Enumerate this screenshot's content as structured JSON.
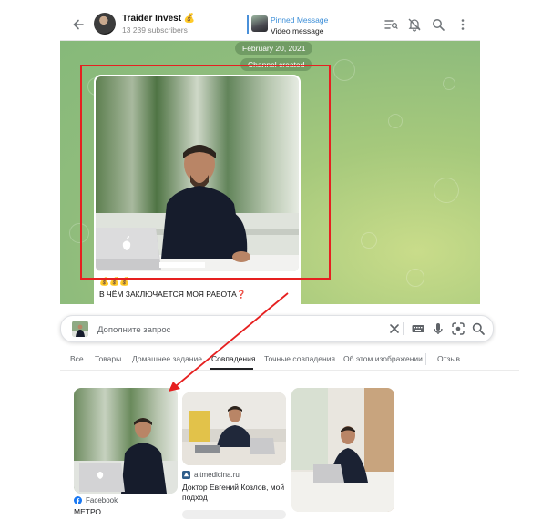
{
  "telegram": {
    "channel_title": "Traider Invest",
    "channel_emoji": "💰",
    "subscribers": "13 239 subscribers",
    "pinned_label": "Pinned Message",
    "pinned_text": "Video message",
    "date_pill": "February 20, 2021",
    "created_pill": "Channel created",
    "message": {
      "emoji_line": "💰💰💰",
      "text": "В ЧЁМ ЗАКЛЮЧАЕТСЯ МОЯ РАБОТА",
      "text_emoji": "❓"
    },
    "icons": [
      "back-arrow-icon",
      "channel-avatar",
      "search-messages-icon",
      "mute-bell-icon",
      "search-icon",
      "more-vert-icon"
    ]
  },
  "annotation": {
    "color": "#e62020"
  },
  "lens": {
    "search": {
      "placeholder": "Дополните запрос"
    },
    "tabs": [
      {
        "label": "Все"
      },
      {
        "label": "Товары"
      },
      {
        "label": "Домашнее задание"
      },
      {
        "label": "Совпадения",
        "active": true
      },
      {
        "label": "Точные совпадения"
      },
      {
        "label": "Об этом изображении"
      },
      {
        "label": "Отзыв"
      }
    ],
    "results": [
      {
        "source": "Facebook",
        "title": "МЕТРО"
      },
      {
        "source": "altmedicina.ru",
        "title": "Доктор Евгений Козлов, мой подход"
      },
      {
        "source": "",
        "title": ""
      }
    ]
  }
}
